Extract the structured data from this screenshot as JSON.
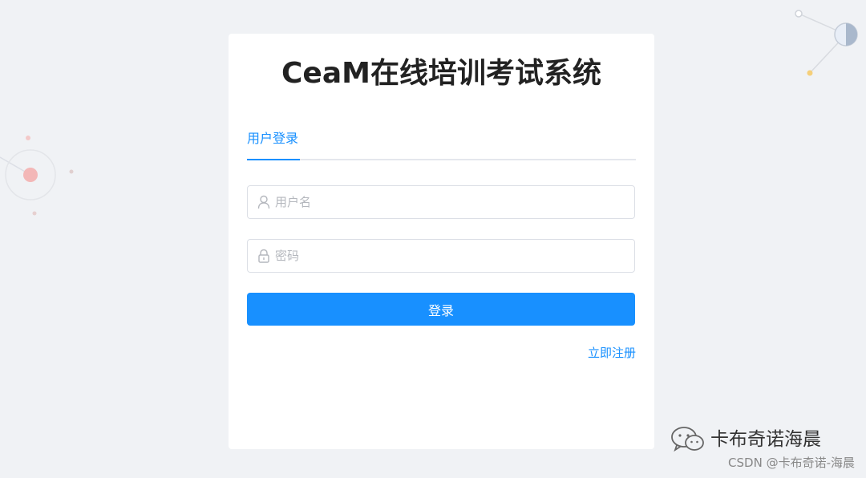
{
  "app": {
    "title": "CeaM在线培训考试系统"
  },
  "tabs": [
    {
      "label": "用户登录",
      "active": true
    }
  ],
  "form": {
    "username": {
      "placeholder": "用户名",
      "value": "",
      "icon": "user-icon"
    },
    "password": {
      "placeholder": "密码",
      "value": "",
      "icon": "lock-icon"
    },
    "login_label": "登录",
    "register_label": "立即注册"
  },
  "watermark": {
    "name": "卡布奇诺海晨",
    "csdn": "CSDN @卡布奇诺-海晨",
    "icon": "wechat-icon"
  },
  "colors": {
    "accent": "#1890ff",
    "background": "#f0f2f5",
    "card": "#ffffff",
    "border": "#dcdfe6"
  }
}
